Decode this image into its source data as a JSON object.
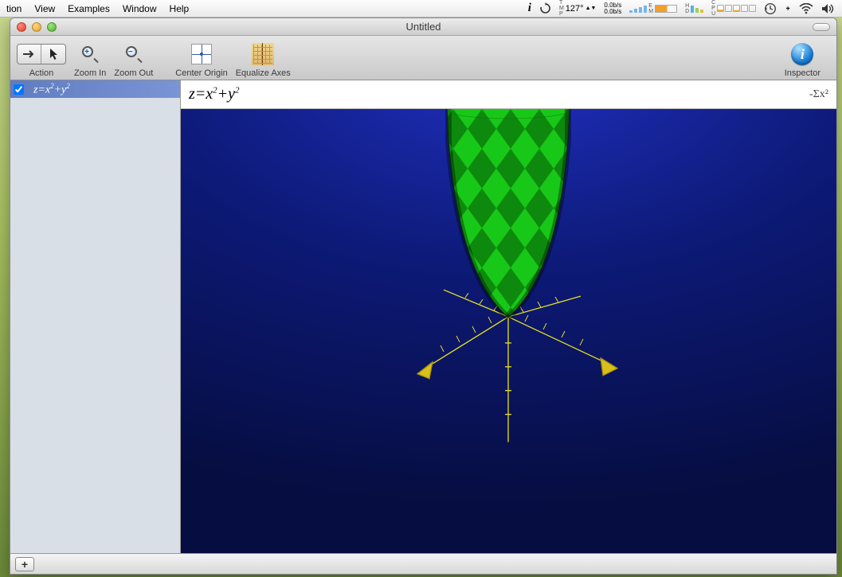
{
  "menubar": {
    "items": [
      "tion",
      "View",
      "Examples",
      "Window",
      "Help"
    ]
  },
  "system_tray": {
    "temperature": "127°",
    "net_up": "0.0b/s",
    "net_down": "0.0b/s",
    "mem_label": "M",
    "mem_sublabel": "E\nM",
    "drive_label1": "H",
    "drive_label2": "D",
    "cpu_label1": "C",
    "cpu_label2": "P\nU"
  },
  "window": {
    "title": "Untitled"
  },
  "toolbar": {
    "action": "Action",
    "zoom_in": "Zoom In",
    "zoom_out": "Zoom Out",
    "center_origin": "Center Origin",
    "equalize_axes": "Equalize Axes",
    "inspector": "Inspector"
  },
  "sidebar": {
    "items": [
      {
        "checked": true,
        "equation_html": "z=x<sup>2</sup>+y<sup>2</sup>",
        "equation_plain": "z=x²+y²"
      }
    ]
  },
  "formula_bar": {
    "equation_html": "z=x<sup>2</sup>+y<sup>2</sup>",
    "equation_plain": "z=x²+y²",
    "sigma": "-Σx²"
  },
  "bottom_bar": {
    "add": "+"
  },
  "chart_data": {
    "type": "surface-3d",
    "equation": "z = x^2 + y^2",
    "description": "3D paraboloid opening upward (elliptic paraboloid), rendered with green/dark-green diamond checker shading, on dark blue gradient background with yellow 3D axes (x, y pointing down-left/down-right with arrowheads, z axis vertical downward with tick marks).",
    "x_range": [
      -3,
      3
    ],
    "y_range": [
      -3,
      3
    ],
    "z_range": [
      0,
      18
    ],
    "axis_color": "#e8e020",
    "surface_colors": [
      "#20e020",
      "#108810"
    ],
    "background": "dark-blue-gradient"
  }
}
